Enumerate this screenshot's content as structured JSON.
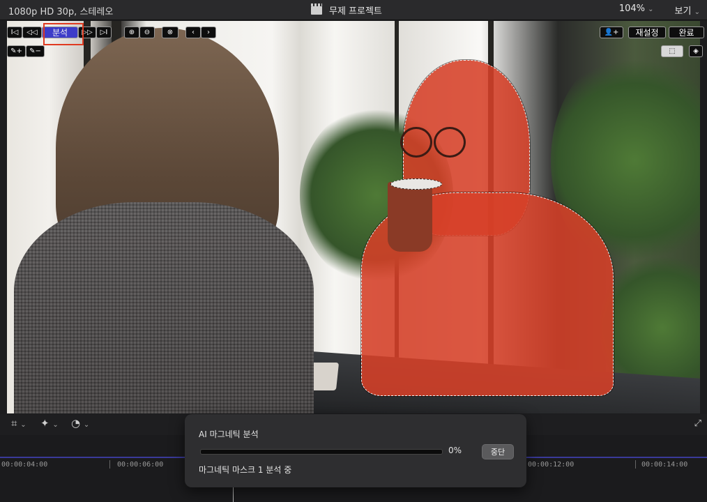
{
  "top_bar": {
    "format": "1080p HD 30p, 스테레오",
    "project_title": "무제 프로젝트",
    "zoom": "104%",
    "view_menu": "보기"
  },
  "viewer_toolbar": {
    "analyze_label": "분석",
    "reset_label": "재설정",
    "done_label": "완료"
  },
  "progress_dialog": {
    "title": "AI 마그네틱 분석",
    "progress_percent": 0,
    "progress_text": "0%",
    "stop_label": "중단",
    "status": "마그네틱 마스크 1 분석 중"
  },
  "timeline": {
    "timecodes": [
      "00:00:04:00",
      "00:00:06:00",
      "00:00:12:00",
      "00:00:14:00"
    ]
  },
  "colors": {
    "mask_overlay": "#d64028",
    "analyze_button": "#3d3dc9",
    "highlight_box": "#e03a20"
  }
}
